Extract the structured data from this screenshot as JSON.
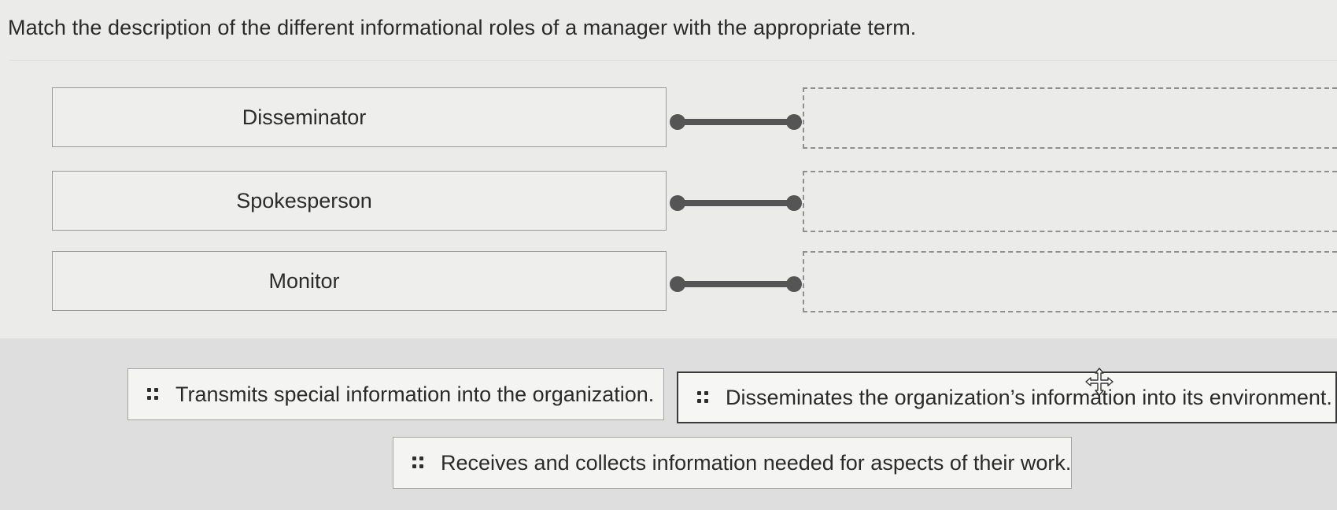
{
  "question": "Match the description of the different informational roles of a manager with the appropriate term.",
  "terms": [
    {
      "label": "Disseminator"
    },
    {
      "label": "Spokesperson"
    },
    {
      "label": "Monitor"
    }
  ],
  "answers": [
    {
      "label": "Transmits special information into the organization.",
      "grip_icon": "drag-handle-icon"
    },
    {
      "label": "Disseminates the organization’s information into its environment.",
      "grip_icon": "drag-handle-icon"
    },
    {
      "label": "Receives and collects information needed for aspects of their work.",
      "grip_icon": "drag-handle-icon"
    }
  ],
  "colors": {
    "connector": "#555555",
    "dashed_border": "#8f8f8f",
    "text": "#2a2a2a"
  },
  "cursor_icon": "move-cursor-icon"
}
